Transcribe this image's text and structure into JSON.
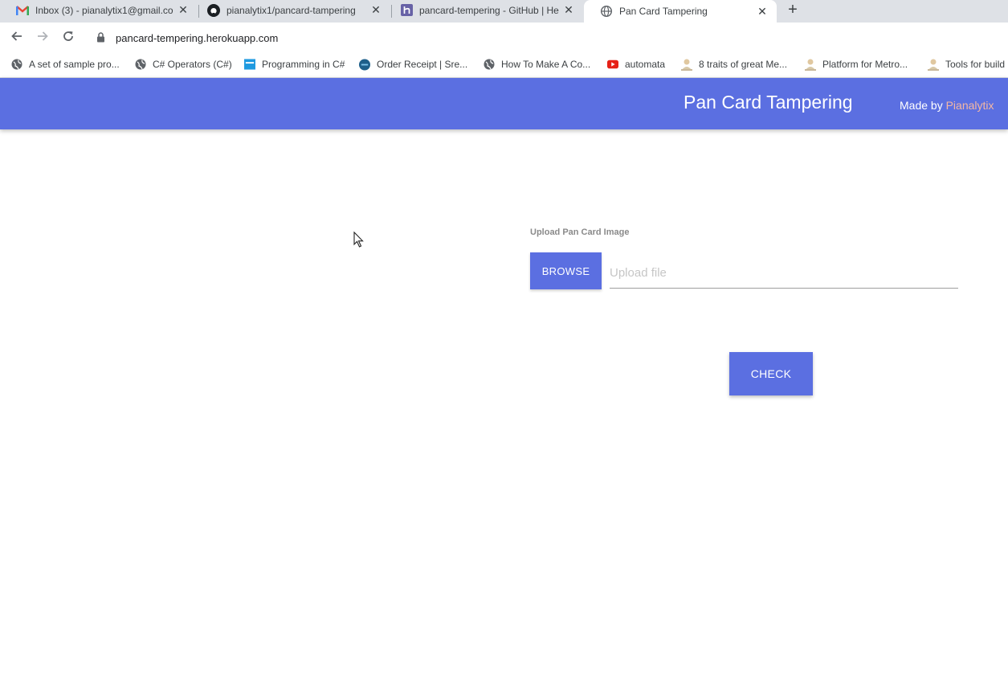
{
  "browser": {
    "tabs": [
      {
        "title": "Inbox (3) - pianalytix1@gmail.co",
        "icon": "gmail-icon",
        "active": false
      },
      {
        "title": "pianalytix1/pancard-tampering",
        "icon": "github-icon",
        "active": false
      },
      {
        "title": "pancard-tempering - GitHub | He",
        "icon": "heroku-icon",
        "active": false
      },
      {
        "title": "Pan Card Tampering",
        "icon": "globe-icon",
        "active": true
      }
    ],
    "close_glyph": "✕",
    "new_tab_glyph": "+",
    "url": "pancard-tempering.herokuapp.com",
    "bookmarks": [
      {
        "label": "A set of sample pro...",
        "icon": "globe-icon"
      },
      {
        "label": "C# Operators (C#)",
        "icon": "globe-icon"
      },
      {
        "label": "Programming in C#",
        "icon": "blue-square-icon"
      },
      {
        "label": "Order Receipt | Sre...",
        "icon": "blue-circle-icon"
      },
      {
        "label": "How To Make A Co...",
        "icon": "globe-icon"
      },
      {
        "label": "automata",
        "icon": "youtube-icon"
      },
      {
        "label": "8 traits of great Me...",
        "icon": "person-icon"
      },
      {
        "label": "Platform for Metro...",
        "icon": "person-icon"
      },
      {
        "label": "Tools for build",
        "icon": "person-icon"
      }
    ]
  },
  "app": {
    "title": "Pan Card Tampering",
    "made_by_prefix": "Made by ",
    "made_by_author": "Pianalytix",
    "upload_label": "Upload Pan Card Image",
    "browse_label": "BROWSE",
    "file_placeholder": "Upload file",
    "check_label": "CHECK"
  },
  "colors": {
    "primary": "#5b6fe1",
    "author_accent": "#f4b7a4"
  }
}
